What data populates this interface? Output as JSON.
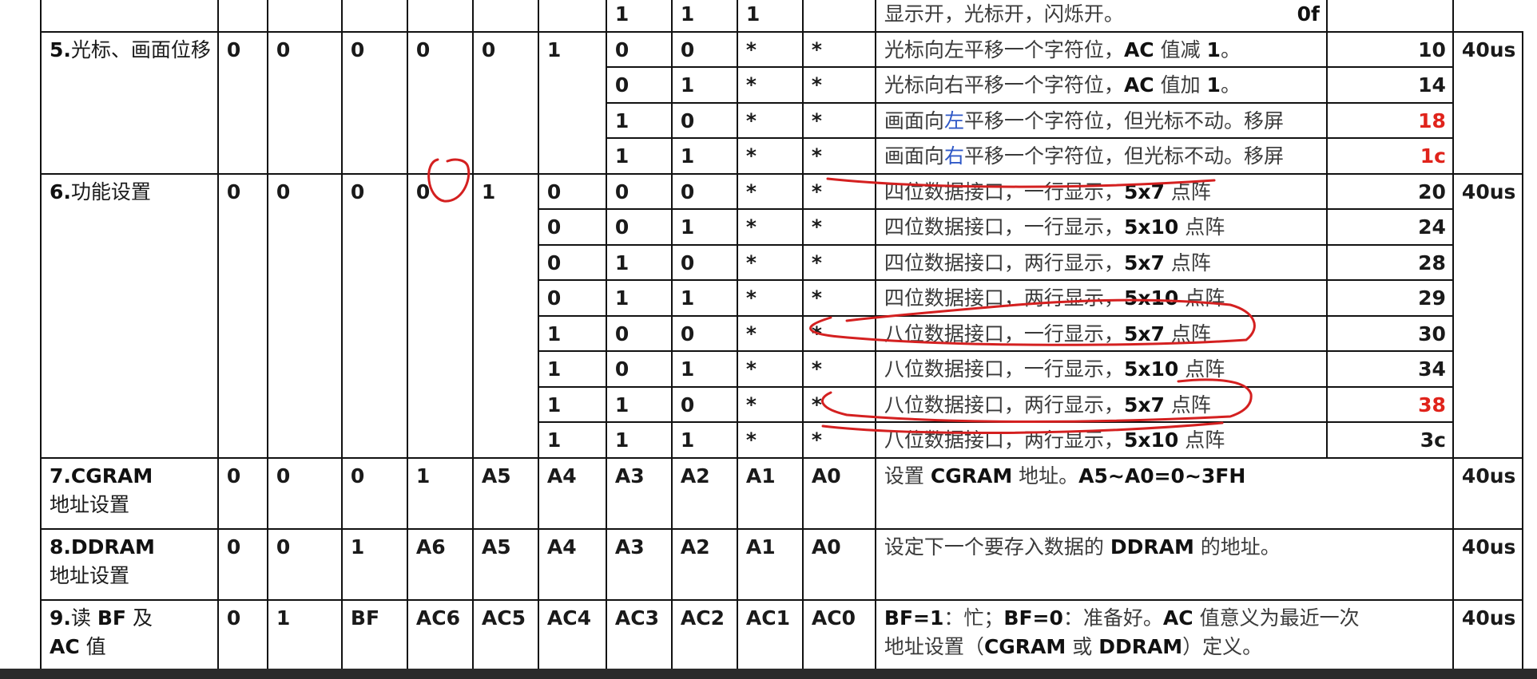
{
  "colors": {
    "annotation": "#d42020",
    "hex_red": "#e0231b",
    "blue_text": "#2f58c7",
    "bar": "#2b2b2b"
  },
  "row_top": {
    "bits": [
      "",
      "",
      "",
      "",
      "",
      "",
      "1",
      "1",
      "1",
      "",
      ""
    ],
    "desc": "显示开，光标开，闪烁开。",
    "hex": "0f"
  },
  "cmd5": {
    "name": [
      "5.",
      "光标、画面位移"
    ],
    "bits": [
      "0",
      "0",
      "0",
      "0",
      "0",
      "1"
    ],
    "time": "40us",
    "rows": [
      {
        "sc": "0",
        "rl": "0",
        "d1": "*",
        "d0": "*",
        "desc": [
          "光标向左平移一个字符位，",
          "AC",
          " 值减 ",
          "1",
          "。"
        ],
        "hex": "10"
      },
      {
        "sc": "0",
        "rl": "1",
        "d1": "*",
        "d0": "*",
        "desc": [
          "光标向右平移一个字符位，",
          "AC",
          " 值加 ",
          "1",
          "。"
        ],
        "hex": "14"
      },
      {
        "sc": "1",
        "rl": "0",
        "d1": "*",
        "d0": "*",
        "desc": [
          "画面向",
          "左",
          "平移一个字符位，但光标不动。移屏"
        ],
        "hex": "18"
      },
      {
        "sc": "1",
        "rl": "1",
        "d1": "*",
        "d0": "*",
        "desc": [
          "画面向",
          "右",
          "平移一个字符位，但光标不动。移屏"
        ],
        "hex": "1c"
      }
    ]
  },
  "cmd6": {
    "name": [
      "6.",
      "功能设置"
    ],
    "bits": [
      "0",
      "0",
      "0",
      "0",
      "1"
    ],
    "time": "40us",
    "rows": [
      {
        "dl": "0",
        "n": "0",
        "f": "0",
        "d1": "*",
        "d0": "*",
        "desc": [
          "四位数据接口，一行显示，",
          "5x7",
          " 点阵"
        ],
        "hex": "20"
      },
      {
        "dl": "0",
        "n": "0",
        "f": "1",
        "d1": "*",
        "d0": "*",
        "desc": [
          "四位数据接口，一行显示，",
          "5x10",
          " 点阵"
        ],
        "hex": "24"
      },
      {
        "dl": "0",
        "n": "1",
        "f": "0",
        "d1": "*",
        "d0": "*",
        "desc": [
          "四位数据接口，两行显示，",
          "5x7",
          " 点阵"
        ],
        "hex": "28"
      },
      {
        "dl": "0",
        "n": "1",
        "f": "1",
        "d1": "*",
        "d0": "*",
        "desc": [
          "四位数据接口，两行显示，",
          "5x10",
          " 点阵"
        ],
        "hex": "29"
      },
      {
        "dl": "1",
        "n": "0",
        "f": "0",
        "d1": "*",
        "d0": "*",
        "desc": [
          "八位数据接口，一行显示，",
          "5x7",
          " 点阵"
        ],
        "hex": "30"
      },
      {
        "dl": "1",
        "n": "0",
        "f": "1",
        "d1": "*",
        "d0": "*",
        "desc": [
          "八位数据接口，一行显示，",
          "5x10",
          " 点阵"
        ],
        "hex": "34"
      },
      {
        "dl": "1",
        "n": "1",
        "f": "0",
        "d1": "*",
        "d0": "*",
        "desc": [
          "八位数据接口，两行显示，",
          "5x7",
          " 点阵"
        ],
        "hex": "38"
      },
      {
        "dl": "1",
        "n": "1",
        "f": "1",
        "d1": "*",
        "d0": "*",
        "desc": [
          "八位数据接口，两行显示，",
          "5x10",
          " 点阵"
        ],
        "hex": "3c"
      }
    ]
  },
  "cmd7": {
    "name": [
      "7.CGRAM",
      "地址设置"
    ],
    "bits": [
      "0",
      "0",
      "0",
      "1",
      "A5",
      "A4",
      "A3",
      "A2",
      "A1",
      "A0"
    ],
    "desc": [
      "设置 ",
      "CGRAM",
      " 地址。",
      "A5~A0=0~3FH"
    ],
    "time": "40us"
  },
  "cmd8": {
    "name": [
      "8.DDRAM",
      "地址设置"
    ],
    "bits": [
      "0",
      "0",
      "1",
      "A6",
      "A5",
      "A4",
      "A3",
      "A2",
      "A1",
      "A0"
    ],
    "desc": [
      "设定下一个要存入数据的 ",
      "DDRAM",
      " 的地址。"
    ],
    "time": "40us"
  },
  "cmd9": {
    "name": [
      "9.",
      "读 ",
      "BF",
      " 及",
      "AC",
      " 值"
    ],
    "bits": [
      "0",
      "1",
      "BF",
      "AC6",
      "AC5",
      "AC4",
      "AC3",
      "AC2",
      "AC1",
      "AC0"
    ],
    "desc": [
      "BF=1",
      "：忙；",
      "BF=0",
      "：准备好。",
      "AC",
      " 值意义为最近一次",
      "地址设置（",
      "CGRAM",
      " 或 ",
      "DDRAM",
      "）定义。"
    ],
    "time": "40us"
  }
}
